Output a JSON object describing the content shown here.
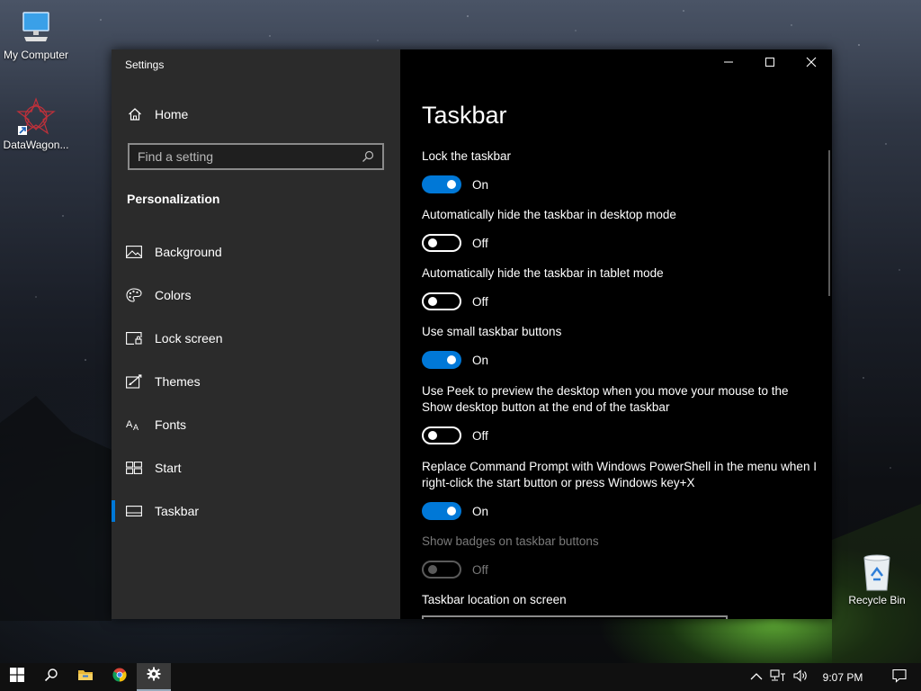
{
  "desktop": {
    "icons": [
      {
        "label": "My Computer",
        "icon": "monitor-icon"
      },
      {
        "label": "DataWagon...",
        "icon": "datawagon-icon"
      },
      {
        "label": "Recycle Bin",
        "icon": "recycle-bin-icon"
      }
    ]
  },
  "window": {
    "title": "Settings",
    "caption": {
      "minimize": "minimize-icon",
      "maximize": "maximize-icon",
      "close": "close-icon"
    }
  },
  "sidebar": {
    "home_label": "Home",
    "search_placeholder": "Find a setting",
    "section_title": "Personalization",
    "items": [
      {
        "label": "Background",
        "icon": "background-icon"
      },
      {
        "label": "Colors",
        "icon": "palette-icon"
      },
      {
        "label": "Lock screen",
        "icon": "lock-screen-icon"
      },
      {
        "label": "Themes",
        "icon": "themes-icon"
      },
      {
        "label": "Fonts",
        "icon": "fonts-icon"
      },
      {
        "label": "Start",
        "icon": "start-icon"
      },
      {
        "label": "Taskbar",
        "icon": "taskbar-icon",
        "active": true
      }
    ]
  },
  "content": {
    "title": "Taskbar",
    "settings": [
      {
        "label": "Lock the taskbar",
        "state": "On"
      },
      {
        "label": "Automatically hide the taskbar in desktop mode",
        "state": "Off"
      },
      {
        "label": "Automatically hide the taskbar in tablet mode",
        "state": "Off"
      },
      {
        "label": "Use small taskbar buttons",
        "state": "On"
      },
      {
        "label": "Use Peek to preview the desktop when you move your mouse to the Show desktop button at the end of the taskbar",
        "state": "Off"
      },
      {
        "label": "Replace Command Prompt with Windows PowerShell in the menu when I right-click the start button or press Windows key+X",
        "state": "On"
      },
      {
        "label": "Show badges on taskbar buttons",
        "state": "Off",
        "disabled": true
      }
    ],
    "location_label": "Taskbar location on screen"
  },
  "taskbar": {
    "apps": [
      "windows-start-icon",
      "search-icon",
      "file-explorer-icon",
      "chrome-icon",
      "settings-gear-icon"
    ],
    "tray": {
      "time": "9:07 PM"
    }
  },
  "colors": {
    "accent": "#0078d7",
    "sidebar_bg": "#2b2b2b",
    "content_bg": "#000000"
  }
}
